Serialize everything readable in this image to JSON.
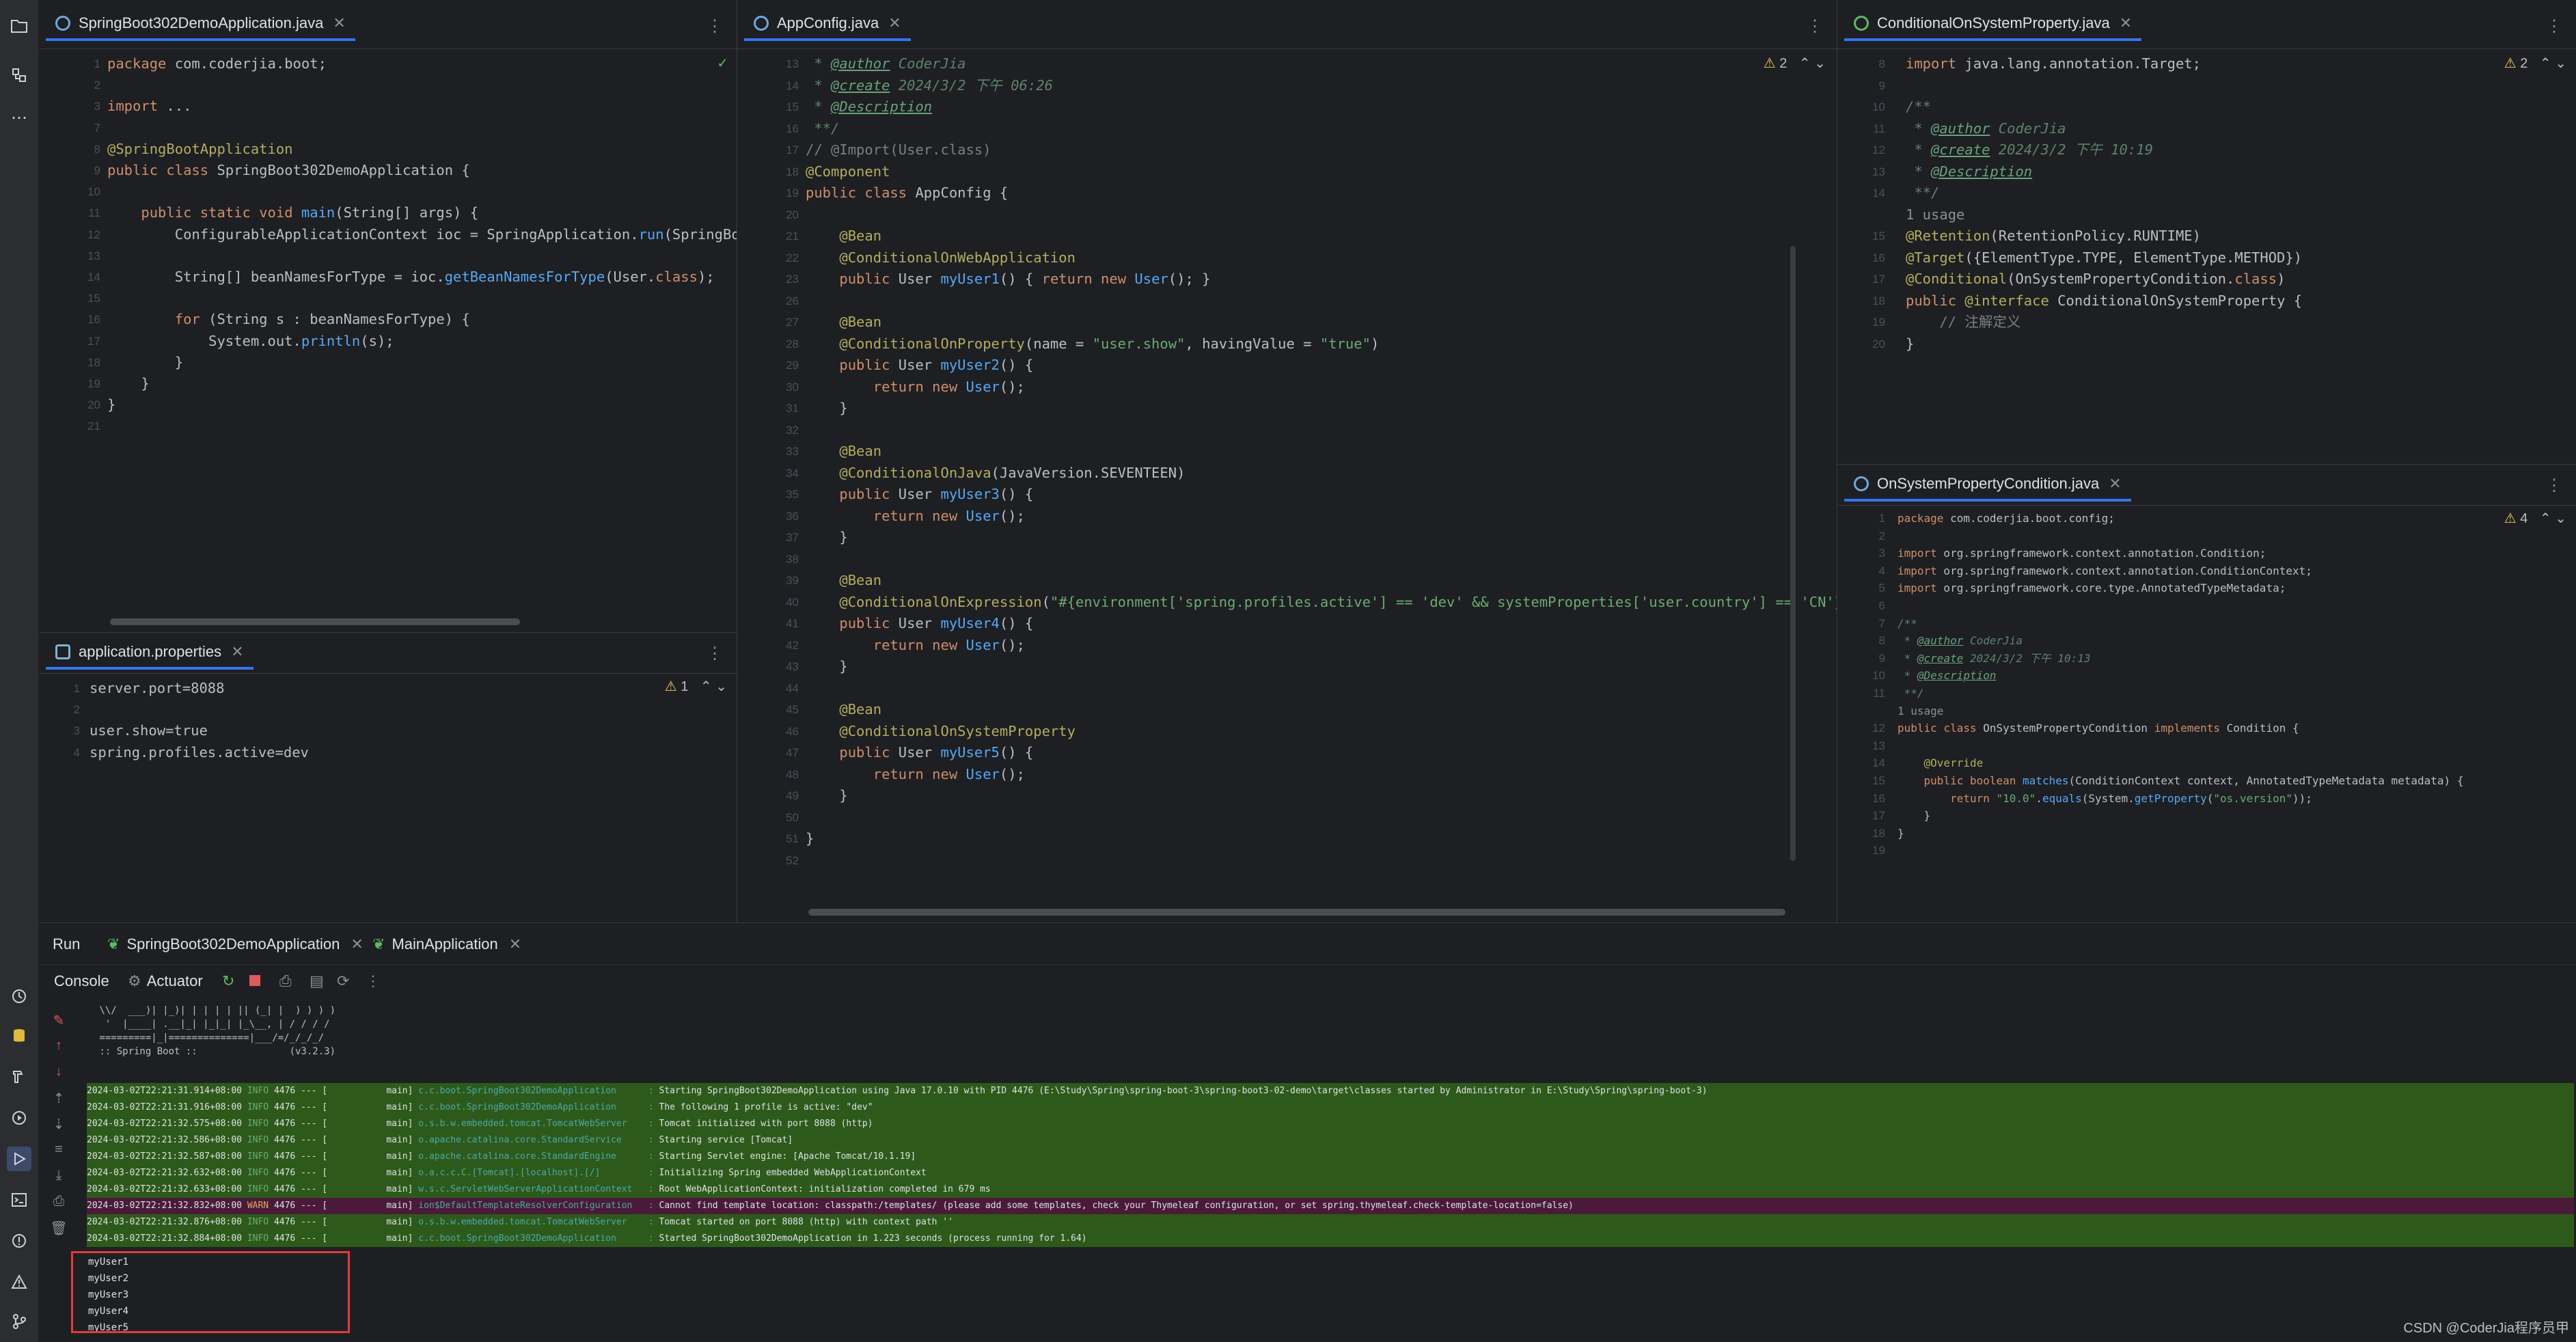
{
  "toolstrip": {
    "top": [
      "folder-icon",
      "structure-icon",
      "more-icon"
    ],
    "bottom": [
      "services-icon",
      "database-icon",
      "build-icon",
      "run-icon",
      "run-active-icon",
      "terminal-icon",
      "problems-icon",
      "warning-icon",
      "git-icon"
    ]
  },
  "pane_main": {
    "tab": "SpringBoot302DemoApplication.java",
    "lines": [
      {
        "n": "1",
        "t": "package com.coderjia.boot;"
      },
      {
        "n": "2",
        "t": ""
      },
      {
        "n": "3",
        "t": "import ..."
      },
      {
        "n": "7",
        "t": ""
      },
      {
        "n": "8",
        "t": "@SpringBootApplication"
      },
      {
        "n": "9",
        "t": "public class SpringBoot302DemoApplication {"
      },
      {
        "n": "10",
        "t": ""
      },
      {
        "n": "11",
        "t": "    public static void main(String[] args) {"
      },
      {
        "n": "12",
        "t": "        ConfigurableApplicationContext ioc = SpringApplication.run(SpringBoo"
      },
      {
        "n": "13",
        "t": ""
      },
      {
        "n": "14",
        "t": "        String[] beanNamesForType = ioc.getBeanNamesForType(User.class);"
      },
      {
        "n": "15",
        "t": ""
      },
      {
        "n": "16",
        "t": "        for (String s : beanNamesForType) {"
      },
      {
        "n": "17",
        "t": "            System.out.println(s);"
      },
      {
        "n": "18",
        "t": "        }"
      },
      {
        "n": "19",
        "t": "    }"
      },
      {
        "n": "20",
        "t": "}"
      },
      {
        "n": "21",
        "t": ""
      }
    ]
  },
  "pane_props": {
    "tab": "application.properties",
    "warnings": "1",
    "lines": [
      {
        "n": "1",
        "t": "server.port=8088"
      },
      {
        "n": "2",
        "t": ""
      },
      {
        "n": "3",
        "t": "user.show=true"
      },
      {
        "n": "4",
        "t": "spring.profiles.active=dev"
      }
    ]
  },
  "pane_config": {
    "tab": "AppConfig.java",
    "warnings": "2",
    "lines": [
      {
        "n": "13",
        "t": " * @author CoderJia"
      },
      {
        "n": "14",
        "t": " * @create 2024/3/2 下午 06:26"
      },
      {
        "n": "15",
        "t": " * @Description"
      },
      {
        "n": "16",
        "t": " **/"
      },
      {
        "n": "17",
        "t": "// @Import(User.class)"
      },
      {
        "n": "18",
        "t": "@Component"
      },
      {
        "n": "19",
        "t": "public class AppConfig {"
      },
      {
        "n": "20",
        "t": ""
      },
      {
        "n": "21",
        "t": "    @Bean"
      },
      {
        "n": "22",
        "t": "    @ConditionalOnWebApplication"
      },
      {
        "n": "23",
        "t": "    public User myUser1() { return new User(); }"
      },
      {
        "n": "26",
        "t": ""
      },
      {
        "n": "27",
        "t": "    @Bean"
      },
      {
        "n": "28",
        "t": "    @ConditionalOnProperty(name = \"user.show\", havingValue = \"true\")"
      },
      {
        "n": "29",
        "t": "    public User myUser2() {"
      },
      {
        "n": "30",
        "t": "        return new User();"
      },
      {
        "n": "31",
        "t": "    }"
      },
      {
        "n": "32",
        "t": ""
      },
      {
        "n": "33",
        "t": "    @Bean"
      },
      {
        "n": "34",
        "t": "    @ConditionalOnJava(JavaVersion.SEVENTEEN)"
      },
      {
        "n": "35",
        "t": "    public User myUser3() {"
      },
      {
        "n": "36",
        "t": "        return new User();"
      },
      {
        "n": "37",
        "t": "    }"
      },
      {
        "n": "38",
        "t": ""
      },
      {
        "n": "39",
        "t": "    @Bean"
      },
      {
        "n": "40",
        "t": "    @ConditionalOnExpression(\"#{environment['spring.profiles.active'] == 'dev' && systemProperties['user.country'] == 'CN'}\")"
      },
      {
        "n": "41",
        "t": "    public User myUser4() {"
      },
      {
        "n": "42",
        "t": "        return new User();"
      },
      {
        "n": "43",
        "t": "    }"
      },
      {
        "n": "44",
        "t": ""
      },
      {
        "n": "45",
        "t": "    @Bean"
      },
      {
        "n": "46",
        "t": "    @ConditionalOnSystemProperty"
      },
      {
        "n": "47",
        "t": "    public User myUser5() {"
      },
      {
        "n": "48",
        "t": "        return new User();"
      },
      {
        "n": "49",
        "t": "    }"
      },
      {
        "n": "50",
        "t": ""
      },
      {
        "n": "51",
        "t": "}"
      },
      {
        "n": "52",
        "t": ""
      }
    ]
  },
  "pane_annotation": {
    "tab": "ConditionalOnSystemProperty.java",
    "warnings": "2",
    "lines": [
      {
        "n": "8",
        "t": "import java.lang.annotation.Target;"
      },
      {
        "n": "9",
        "t": ""
      },
      {
        "n": "10",
        "t": "/**"
      },
      {
        "n": "11",
        "t": " * @author CoderJia"
      },
      {
        "n": "12",
        "t": " * @create 2024/3/2 下午 10:19"
      },
      {
        "n": "13",
        "t": " * @Description"
      },
      {
        "n": "14",
        "t": " **/"
      },
      {
        "n": "",
        "t": "1 usage"
      },
      {
        "n": "15",
        "t": "@Retention(RetentionPolicy.RUNTIME)"
      },
      {
        "n": "16",
        "t": "@Target({ElementType.TYPE, ElementType.METHOD})"
      },
      {
        "n": "17",
        "t": "@Conditional(OnSystemPropertyCondition.class)"
      },
      {
        "n": "18",
        "t": "public @interface ConditionalOnSystemProperty {"
      },
      {
        "n": "19",
        "t": "    // 注解定义"
      },
      {
        "n": "20",
        "t": "}"
      }
    ]
  },
  "pane_condition": {
    "tab": "OnSystemPropertyCondition.java",
    "warnings": "4",
    "lines": [
      {
        "n": "1",
        "t": "package com.coderjia.boot.config;"
      },
      {
        "n": "2",
        "t": ""
      },
      {
        "n": "3",
        "t": "import org.springframework.context.annotation.Condition;"
      },
      {
        "n": "4",
        "t": "import org.springframework.context.annotation.ConditionContext;"
      },
      {
        "n": "5",
        "t": "import org.springframework.core.type.AnnotatedTypeMetadata;"
      },
      {
        "n": "6",
        "t": ""
      },
      {
        "n": "7",
        "t": "/**"
      },
      {
        "n": "8",
        "t": " * @author CoderJia"
      },
      {
        "n": "9",
        "t": " * @create 2024/3/2 下午 10:13"
      },
      {
        "n": "10",
        "t": " * @Description"
      },
      {
        "n": "11",
        "t": " **/"
      },
      {
        "n": "",
        "t": "1 usage"
      },
      {
        "n": "12",
        "t": "public class OnSystemPropertyCondition implements Condition {"
      },
      {
        "n": "13",
        "t": ""
      },
      {
        "n": "14",
        "t": "    @Override"
      },
      {
        "n": "15",
        "t": "    public boolean matches(ConditionContext context, AnnotatedTypeMetadata metadata) {"
      },
      {
        "n": "16",
        "t": "        return \"10.0\".equals(System.getProperty(\"os.version\"));"
      },
      {
        "n": "17",
        "t": "    }"
      },
      {
        "n": "18",
        "t": "}"
      },
      {
        "n": "19",
        "t": ""
      }
    ]
  },
  "run": {
    "title": "Run",
    "tabs": [
      "SpringBoot302DemoApplication",
      "MainApplication"
    ],
    "subtabs": [
      "Console",
      "Actuator"
    ],
    "banner": [
      " \\\\/  ___)| |_)| | | | | || (_| |  ) ) ) )",
      "  '  |____| .__|_| |_|_| |_\\__, | / / / /",
      " =========|_|==============|___/=/_/_/_/",
      " :: Spring Boot ::                (v3.2.3)"
    ],
    "logs": [
      {
        "ts": "2024-03-02T22:21:31.914+08:00",
        "lvl": "INFO",
        "pid": "4476",
        "thread": "main",
        "cls": "c.c.boot.SpringBoot302DemoApplication",
        "msg": "Starting SpringBoot302DemoApplication using Java 17.0.10 with PID 4476 (E:\\Study\\Spring\\spring-boot-3\\spring-boot3-02-demo\\target\\classes started by Administrator in E:\\Study\\Spring\\spring-boot-3)"
      },
      {
        "ts": "2024-03-02T22:21:31.916+08:00",
        "lvl": "INFO",
        "pid": "4476",
        "thread": "main",
        "cls": "c.c.boot.SpringBoot302DemoApplication",
        "msg": "The following 1 profile is active: \"dev\""
      },
      {
        "ts": "2024-03-02T22:21:32.575+08:00",
        "lvl": "INFO",
        "pid": "4476",
        "thread": "main",
        "cls": "o.s.b.w.embedded.tomcat.TomcatWebServer",
        "msg": "Tomcat initialized with port 8088 (http)"
      },
      {
        "ts": "2024-03-02T22:21:32.586+08:00",
        "lvl": "INFO",
        "pid": "4476",
        "thread": "main",
        "cls": "o.apache.catalina.core.StandardService",
        "msg": "Starting service [Tomcat]"
      },
      {
        "ts": "2024-03-02T22:21:32.587+08:00",
        "lvl": "INFO",
        "pid": "4476",
        "thread": "main",
        "cls": "o.apache.catalina.core.StandardEngine",
        "msg": "Starting Servlet engine: [Apache Tomcat/10.1.19]"
      },
      {
        "ts": "2024-03-02T22:21:32.632+08:00",
        "lvl": "INFO",
        "pid": "4476",
        "thread": "main",
        "cls": "o.a.c.c.C.[Tomcat].[localhost].[/]",
        "msg": "Initializing Spring embedded WebApplicationContext"
      },
      {
        "ts": "2024-03-02T22:21:32.633+08:00",
        "lvl": "INFO",
        "pid": "4476",
        "thread": "main",
        "cls": "w.s.c.ServletWebServerApplicationContext",
        "msg": "Root WebApplicationContext: initialization completed in 679 ms"
      },
      {
        "ts": "2024-03-02T22:21:32.832+08:00",
        "lvl": "WARN",
        "pid": "4476",
        "thread": "main",
        "cls": "ion$DefaultTemplateResolverConfiguration",
        "msg": "Cannot find template location: classpath:/templates/ (please add some templates, check your Thymeleaf configuration, or set spring.thymeleaf.check-template-location=false)"
      },
      {
        "ts": "2024-03-02T22:21:32.876+08:00",
        "lvl": "INFO",
        "pid": "4476",
        "thread": "main",
        "cls": "o.s.b.w.embedded.tomcat.TomcatWebServer",
        "msg": "Tomcat started on port 8088 (http) with context path ''"
      },
      {
        "ts": "2024-03-02T22:21:32.884+08:00",
        "lvl": "INFO",
        "pid": "4476",
        "thread": "main",
        "cls": "c.c.boot.SpringBoot302DemoApplication",
        "msg": "Started SpringBoot302DemoApplication in 1.223 seconds (process running for 1.64)"
      }
    ],
    "output": [
      "myUser1",
      "myUser2",
      "myUser3",
      "myUser4",
      "myUser5"
    ]
  },
  "watermark": "CSDN @CoderJia程序员甲",
  "colors": {
    "highlight_box": "#e03c3c",
    "info_row": "#2d5a1b",
    "warn_row": "#4b1a3a"
  }
}
